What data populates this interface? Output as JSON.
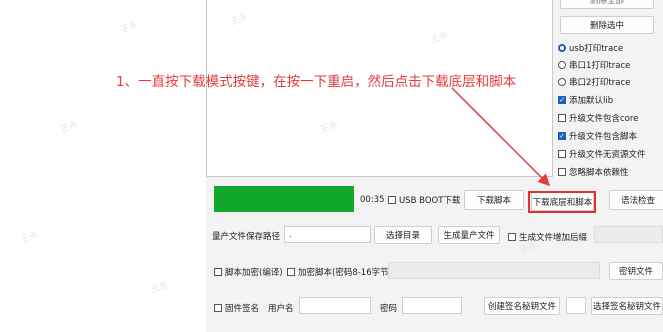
{
  "top_button_partial": "删除全部",
  "delete_selected": "删除选中",
  "options": {
    "usb_trace": "usb打印trace",
    "uart1_trace": "串口1打印trace",
    "uart2_trace": "串口2打印trace",
    "add_default_lib": "添加默认lib",
    "upgrade_core": "升级文件包含core",
    "upgrade_script": "升级文件包含脚本",
    "upgrade_no_resource": "升级文件无资源文件",
    "ignore_script_dep": "忽略脚本依赖性"
  },
  "progress": {
    "fraction": 1.0,
    "time": "00:35"
  },
  "usb_boot_download": "USB BOOT下载",
  "download_script": "下载脚本",
  "download_base_script": "下载底层和脚本",
  "syntax_check": "语法检查",
  "mass_file_path_label": "量产文件保存路径",
  "mass_file_path_value": ".",
  "select_dir": "选择目录",
  "generate_mass_file": "生成量产文件",
  "mass_file_suffix": "生成文件增加后缀",
  "script_encrypt": "脚本加密(编译)",
  "encrypt_script": "加密脚本(密码8-16字节)",
  "key_file": "密钥文件",
  "firmware_sign": "固件签名",
  "username_label": "用户名",
  "password_label": "密码",
  "create_sign_key": "创建签名秘钥文件",
  "select_sign_key": "选择签名秘钥文件",
  "annotation": "1、一直按下载模式按键，在按一下重启，然后点击下载底层和脚本",
  "watermark": "王永",
  "colors": {
    "annotation": "#e53b3b",
    "progress": "#11a82c",
    "accent": "#1f5fbf"
  }
}
